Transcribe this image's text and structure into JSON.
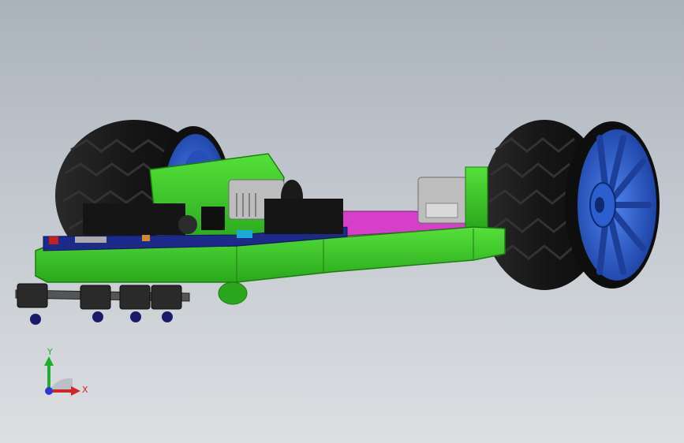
{
  "viewport": {
    "background_top": "#aab2bc",
    "background_bottom": "#dcdfe2"
  },
  "model": {
    "name_icon": "line-follower-robot-3d-model",
    "colors": {
      "chassis": "#3fd12a",
      "chassis_dark": "#2a9a1b",
      "plate": "#d63fc7",
      "tire": "#1a1a1a",
      "hub": "#2f64d8",
      "hub_dark": "#1d3f9a",
      "board": "#1c2a8a",
      "headers": "#151515",
      "motor": "#b7b7b7"
    }
  },
  "triad": {
    "y_label": "Y",
    "x_label": "X",
    "y_color": "#1fae2d",
    "x_color": "#d42424",
    "z_color": "#2a3bd1"
  }
}
